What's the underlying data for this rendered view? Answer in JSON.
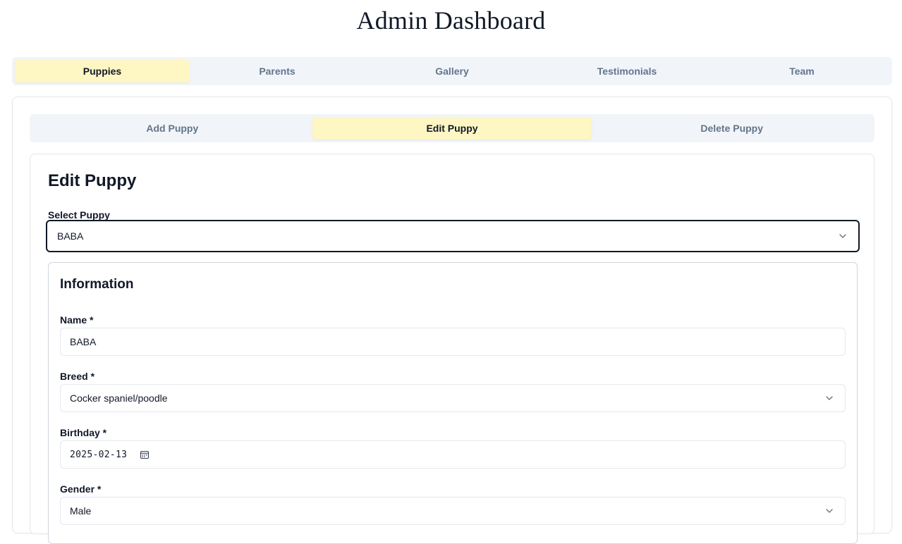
{
  "header": {
    "title": "Admin Dashboard"
  },
  "main_tabs": [
    {
      "label": "Puppies",
      "active": true
    },
    {
      "label": "Parents",
      "active": false
    },
    {
      "label": "Gallery",
      "active": false
    },
    {
      "label": "Testimonials",
      "active": false
    },
    {
      "label": "Team",
      "active": false
    }
  ],
  "sub_tabs": [
    {
      "label": "Add Puppy",
      "active": false
    },
    {
      "label": "Edit Puppy",
      "active": true
    },
    {
      "label": "Delete Puppy",
      "active": false
    }
  ],
  "edit": {
    "title": "Edit Puppy",
    "select_label": "Select Puppy",
    "select_value": "BABA"
  },
  "info": {
    "title": "Information",
    "name_label": "Name *",
    "name_value": "BABA",
    "breed_label": "Breed *",
    "breed_value": "Cocker spaniel/poodle",
    "birthday_label": "Birthday *",
    "birthday_value": "2025-02-13",
    "gender_label": "Gender *",
    "gender_value": "Male"
  },
  "colors": {
    "active_tab": "#fef6c3",
    "tab_bar": "#f1f5f9",
    "inactive_text": "#64748b"
  },
  "icons": [
    "chevron-down-icon",
    "calendar-icon"
  ]
}
